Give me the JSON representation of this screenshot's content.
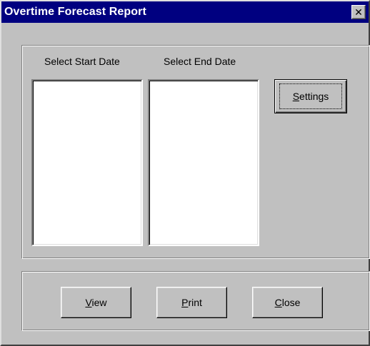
{
  "window": {
    "title": "Overtime Forecast Report",
    "close_glyph": "✕"
  },
  "dates": {
    "start_label": "Select Start Date",
    "end_label": "Select End Date"
  },
  "buttons": {
    "settings": {
      "mnemonic": "S",
      "rest": "ettings"
    },
    "view": {
      "mnemonic": "V",
      "rest": "iew"
    },
    "print": {
      "mnemonic": "P",
      "rest": "rint"
    },
    "close": {
      "mnemonic": "C",
      "rest": "lose"
    }
  },
  "colors": {
    "titlebar": "#000080",
    "face": "#c0c0c0"
  }
}
